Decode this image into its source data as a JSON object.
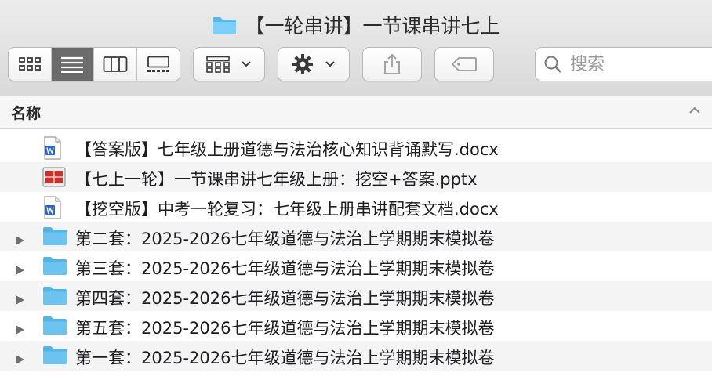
{
  "window": {
    "title": "【一轮串讲】一节课串讲七上",
    "title_icon": "folder-icon"
  },
  "toolbar": {
    "view_modes": [
      {
        "icon": "icon-view-icon",
        "active": false
      },
      {
        "icon": "list-view-icon",
        "active": true
      },
      {
        "icon": "column-view-icon",
        "active": false
      },
      {
        "icon": "gallery-view-icon",
        "active": false
      }
    ],
    "search": {
      "placeholder": "搜索"
    }
  },
  "list_header": {
    "name_label": "名称"
  },
  "items": [
    {
      "kind": "file",
      "icon": "word-doc-icon",
      "name": "【答案版】七年级上册道德与法治核心知识背诵默写.docx"
    },
    {
      "kind": "file",
      "icon": "powerpoint-icon",
      "name": "【七上一轮】一节课串讲七年级上册：挖空+答案.pptx"
    },
    {
      "kind": "file",
      "icon": "word-doc-icon",
      "name": "【挖空版】中考一轮复习：七年级上册串讲配套文档.docx"
    },
    {
      "kind": "folder",
      "icon": "folder-icon",
      "name": "第二套：2025-2026七年级道德与法治上学期期末模拟卷"
    },
    {
      "kind": "folder",
      "icon": "folder-icon",
      "name": "第三套：2025-2026七年级道德与法治上学期期末模拟卷"
    },
    {
      "kind": "folder",
      "icon": "folder-icon",
      "name": "第四套：2025-2026七年级道德与法治上学期期末模拟卷"
    },
    {
      "kind": "folder",
      "icon": "folder-icon",
      "name": "第五套：2025-2026七年级道德与法治上学期期末模拟卷"
    },
    {
      "kind": "folder",
      "icon": "folder-icon",
      "name": "第一套：2025-2026七年级道德与法治上学期期末模拟卷"
    }
  ],
  "colors": {
    "folder": "#6cc3f0",
    "active_view": "#6b6b6b",
    "stripe": "#f4f4f5"
  }
}
